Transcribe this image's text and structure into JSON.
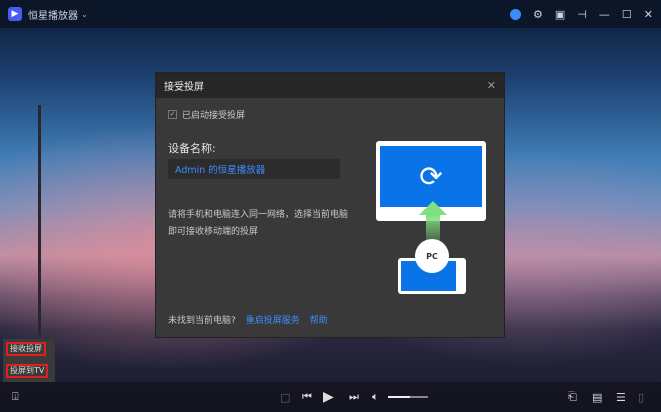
{
  "app": {
    "title": "恒星播放器",
    "logo_icon": "play-logo"
  },
  "dialog": {
    "title": "接受投屏",
    "enabled_label": "已启动接受投屏",
    "enabled": true,
    "device_label": "设备名称:",
    "device_name": "Admin 的恒星播放器",
    "description": "请将手机和电脑连入同一网络，选择当前电脑即可接收移动端的投屏",
    "not_found": "未找到当前电脑?",
    "restart_link": "重启投屏服务",
    "help_link": "帮助",
    "pc_badge": "PC"
  },
  "cast_menu": {
    "items": [
      "接收投屏",
      "投屏到TV"
    ]
  },
  "player": {
    "volume": 55
  },
  "colors": {
    "accent": "#3d8cff",
    "highlight": "#e02020"
  }
}
